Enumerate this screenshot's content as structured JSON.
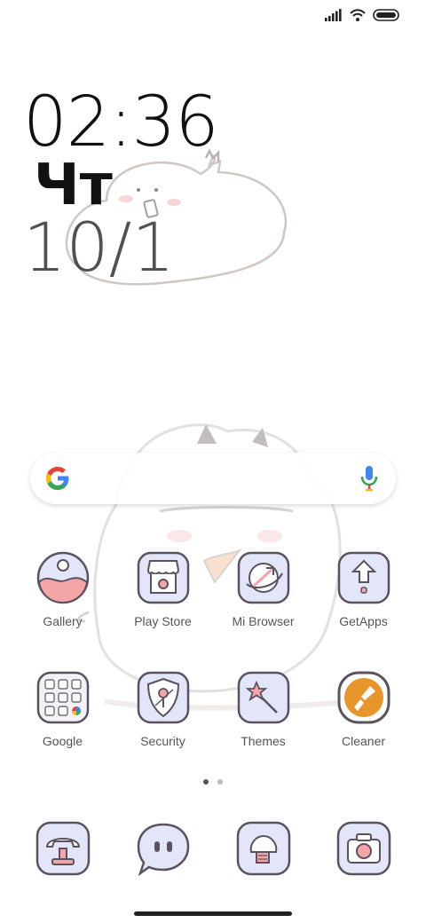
{
  "status_bar": {
    "signal_icon": "cellular-signal-icon",
    "wifi_icon": "wifi-icon",
    "battery_icon": "battery-icon"
  },
  "clock": {
    "time": "02:36",
    "day": "Чт",
    "date": "10/1"
  },
  "search": {
    "logo_icon": "google-g-icon",
    "mic_icon": "microphone-icon"
  },
  "apps_row1": [
    {
      "label": "Gallery",
      "icon": "gallery-icon"
    },
    {
      "label": "Play Store",
      "icon": "play-store-icon"
    },
    {
      "label": "Mi Browser",
      "icon": "browser-icon"
    },
    {
      "label": "GetApps",
      "icon": "getapps-icon"
    }
  ],
  "apps_row2": [
    {
      "label": "Google",
      "icon": "google-folder-icon"
    },
    {
      "label": "Security",
      "icon": "security-icon"
    },
    {
      "label": "Themes",
      "icon": "themes-icon"
    },
    {
      "label": "Cleaner",
      "icon": "cleaner-icon"
    }
  ],
  "page_indicator": {
    "pages": 2,
    "current": 1
  },
  "dock": [
    {
      "icon": "phone-icon"
    },
    {
      "icon": "messages-icon"
    },
    {
      "icon": "browser-dock-icon"
    },
    {
      "icon": "camera-icon"
    }
  ],
  "colors": {
    "icon_fill": "#e3e6f8",
    "icon_stroke": "#5b5260",
    "accent_pink": "#f3a5a8",
    "cleaner_orange": "#e8952c"
  }
}
